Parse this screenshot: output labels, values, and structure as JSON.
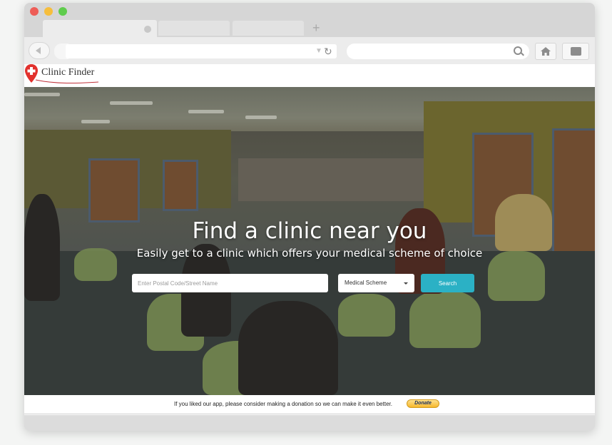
{
  "browser": {
    "new_tab_label": "+"
  },
  "site": {
    "logo_text": "Clinic Finder"
  },
  "hero": {
    "title": "Find a clinic near you",
    "subtitle": "Easily get to a clinic which offers your medical scheme of choice"
  },
  "search_form": {
    "postal_placeholder": "Enter Postal Code/Street Name",
    "scheme_label": "Medical Scheme",
    "search_button": "Search"
  },
  "footer": {
    "message": "If you liked our app, please consider making a donation so we can make it even better.",
    "donate_label": "Donate"
  },
  "colors": {
    "accent": "#2bb1c5",
    "logo_red": "#e2312d",
    "donate": "#f7b82c"
  }
}
